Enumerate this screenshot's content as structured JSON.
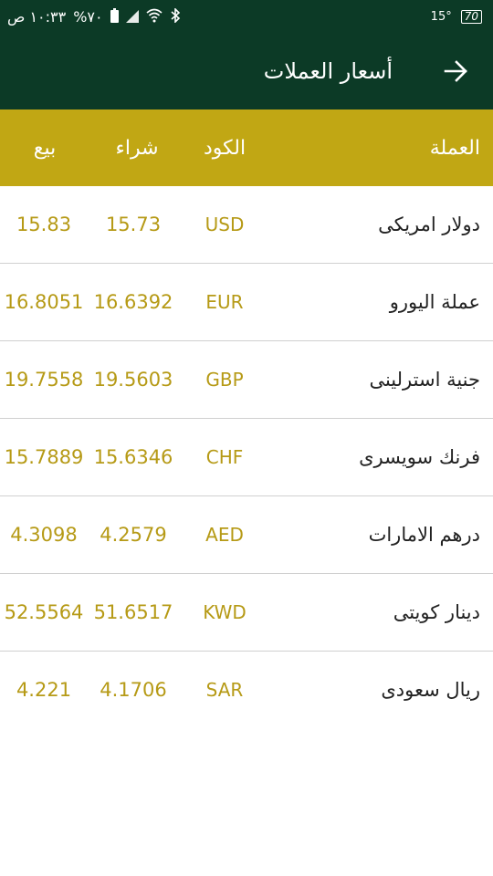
{
  "status_bar": {
    "time": "١٠:٣٣ ص",
    "battery_percent": "%٧٠",
    "temperature": "15°",
    "battery_box": "70"
  },
  "app_bar": {
    "title": "أسعار العملات",
    "back_icon": "arrow-right-icon"
  },
  "colors": {
    "primary_dark": "#0c3a26",
    "header_gold": "#c1a714",
    "value_gold": "#b69a16"
  },
  "table": {
    "headers": {
      "currency": "العملة",
      "code": "الكود",
      "buy": "شراء",
      "sell": "بيع"
    },
    "rows": [
      {
        "name": "دولار امريكى",
        "code": "USD",
        "buy": "15.73",
        "sell": "15.83"
      },
      {
        "name": "عملة اليورو",
        "code": "EUR",
        "buy": "16.6392",
        "sell": "16.8051"
      },
      {
        "name": "جنية استرلينى",
        "code": "GBP",
        "buy": "19.5603",
        "sell": "19.7558"
      },
      {
        "name": "فرنك سويسرى",
        "code": "CHF",
        "buy": "15.6346",
        "sell": "15.7889"
      },
      {
        "name": "درهم الامارات",
        "code": "AED",
        "buy": "4.2579",
        "sell": "4.3098"
      },
      {
        "name": "دينار كويتى",
        "code": "KWD",
        "buy": "51.6517",
        "sell": "52.5564"
      },
      {
        "name": "ريال سعودى",
        "code": "SAR",
        "buy": "4.1706",
        "sell": "4.221"
      }
    ]
  }
}
